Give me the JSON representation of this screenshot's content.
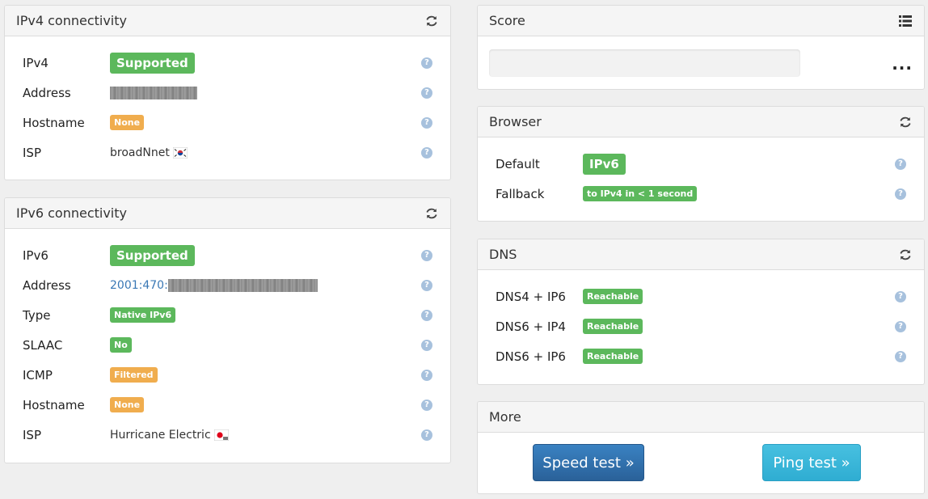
{
  "ipv4": {
    "title": "IPv4 connectivity",
    "rows": [
      {
        "label": "IPv4",
        "value": "Supported"
      },
      {
        "label": "Address",
        "value": ""
      },
      {
        "label": "Hostname",
        "value": "None"
      },
      {
        "label": "ISP",
        "value": "broadNnet"
      }
    ]
  },
  "ipv6": {
    "title": "IPv6 connectivity",
    "rows": [
      {
        "label": "IPv6",
        "value": "Supported"
      },
      {
        "label": "Address",
        "value": "2001:470:"
      },
      {
        "label": "Type",
        "value": "Native IPv6"
      },
      {
        "label": "SLAAC",
        "value": "No"
      },
      {
        "label": "ICMP",
        "value": "Filtered"
      },
      {
        "label": "Hostname",
        "value": "None"
      },
      {
        "label": "ISP",
        "value": "Hurricane Electric"
      }
    ]
  },
  "score": {
    "title": "Score",
    "more": "..."
  },
  "browser": {
    "title": "Browser",
    "rows": [
      {
        "label": "Default",
        "value": "IPv6"
      },
      {
        "label": "Fallback",
        "value": "to IPv4 in < 1 second"
      }
    ]
  },
  "dns": {
    "title": "DNS",
    "rows": [
      {
        "label": "DNS4 + IP6",
        "value": "Reachable"
      },
      {
        "label": "DNS6 + IP4",
        "value": "Reachable"
      },
      {
        "label": "DNS6 + IP6",
        "value": "Reachable"
      }
    ]
  },
  "more": {
    "title": "More",
    "speed_label": "Speed test »",
    "ping_label": "Ping test »"
  },
  "help_glyph": "?",
  "colors": {
    "success": "#5cb85c",
    "warning": "#f0ad4e",
    "primary": "#2e6da4",
    "info": "#3ab7d8",
    "link": "#3a78b5"
  }
}
